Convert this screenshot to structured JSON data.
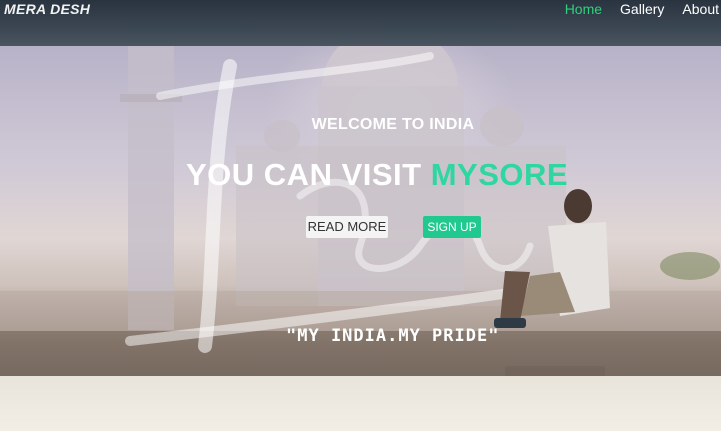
{
  "navbar": {
    "brand": "MERA DESH",
    "links": [
      {
        "label": "Home",
        "active": true
      },
      {
        "label": "Gallery",
        "active": false
      },
      {
        "label": "About",
        "active": false
      }
    ]
  },
  "hero": {
    "welcome": "WELCOME TO INDIA",
    "headline_prefix": "YOU CAN VISIT",
    "headline_accent": "MYSORE",
    "read_more_label": "READ MORE",
    "sign_up_label": "SIGN UP",
    "tagline": "\"MY INDIA.MY PRIDE\"",
    "script_overlay": "India"
  },
  "colors": {
    "navbar_bg": "#2a3440",
    "accent": "#2fd6a0",
    "active_link": "#2fd07a",
    "sign_up_bg": "#21c98f"
  }
}
